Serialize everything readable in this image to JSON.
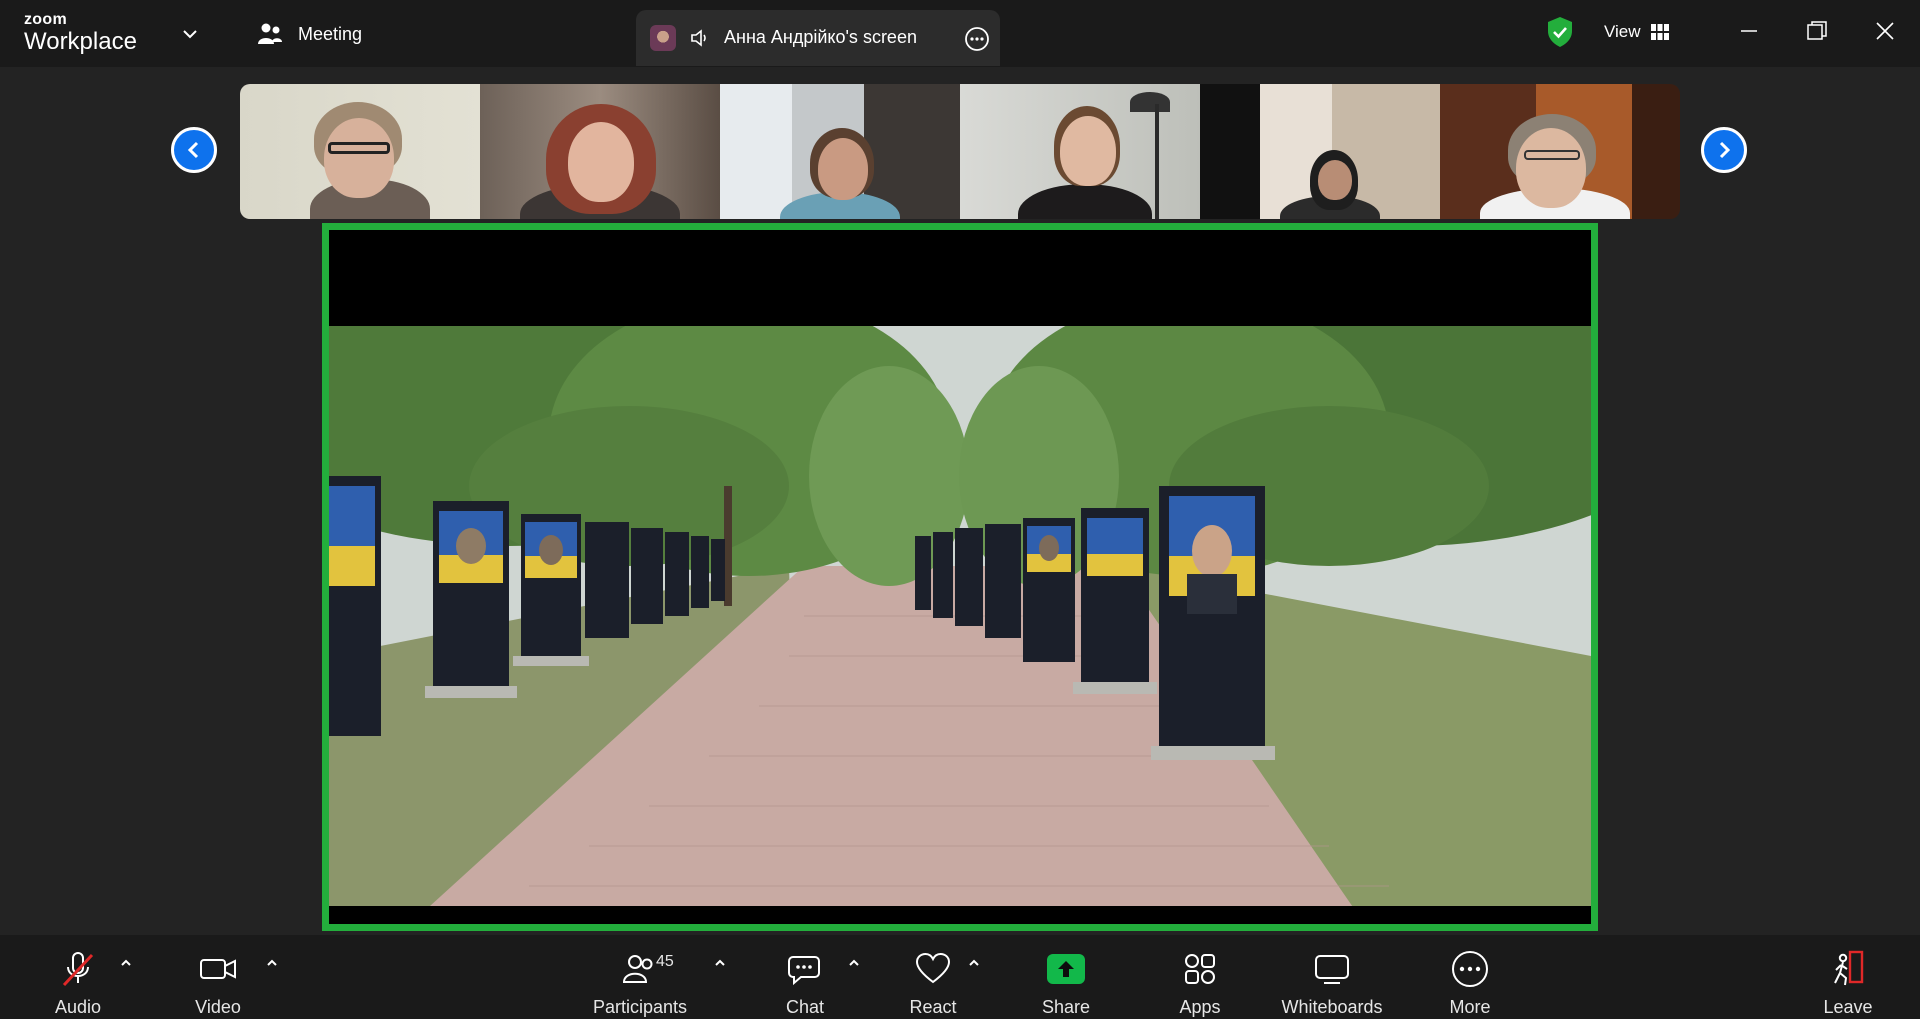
{
  "app": {
    "logo_small": "zoom",
    "logo_big": "Workplace"
  },
  "topbar": {
    "meeting_label": "Meeting",
    "screen_share_label": "Анна Андрійко's screen",
    "view_label": "View",
    "security_color": "#23ae3c"
  },
  "gallery": {
    "participant_count_visible": 6
  },
  "share": {
    "border_color": "#23ae3c"
  },
  "toolbar": {
    "audio_label": "Audio",
    "video_label": "Video",
    "participants_label": "Participants",
    "participants_count": "45",
    "chat_label": "Chat",
    "react_label": "React",
    "share_label": "Share",
    "apps_label": "Apps",
    "whiteboards_label": "Whiteboards",
    "more_label": "More",
    "leave_label": "Leave",
    "share_color": "#12b84a",
    "leave_color": "#e02828"
  },
  "icons": {
    "chevron": "chevron-down-icon",
    "participants": "people-icon",
    "speaker": "speaker-icon",
    "more": "more-icon",
    "shield": "shield-check-icon",
    "grid": "grid-icon",
    "minimize": "minimize-icon",
    "restore": "restore-icon",
    "close": "close-icon",
    "prev": "chevron-left-icon",
    "next": "chevron-right-icon",
    "mic": "mic-muted-icon",
    "camera": "camera-icon",
    "chat": "chat-icon",
    "heart": "heart-icon",
    "share": "share-arrow-icon",
    "apps": "apps-icon",
    "whiteboard": "whiteboard-icon",
    "leave": "leave-icon"
  }
}
